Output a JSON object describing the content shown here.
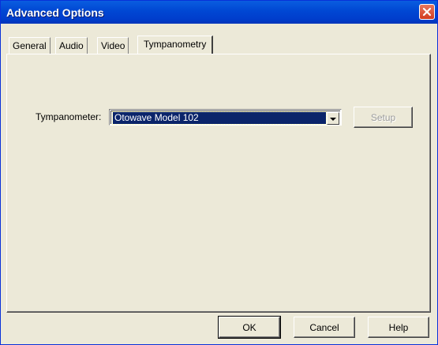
{
  "window": {
    "title": "Advanced Options"
  },
  "tabs": [
    {
      "label": "General"
    },
    {
      "label": "Audio"
    },
    {
      "label": "Video"
    },
    {
      "label": "Tympanometry",
      "active": true
    }
  ],
  "tympanometry": {
    "tympanometer_label": "Tympanometer:",
    "selected_device": "Otowave Model 102",
    "setup_label": "Setup",
    "setup_enabled": false
  },
  "footer": {
    "ok_label": "OK",
    "cancel_label": "Cancel",
    "help_label": "Help"
  },
  "colors": {
    "titlebar": "#0047d3",
    "face": "#ece9d8",
    "selection": "#0a246a"
  },
  "icons": {
    "close": "close-icon",
    "dropdown": "chevron-down-icon"
  }
}
